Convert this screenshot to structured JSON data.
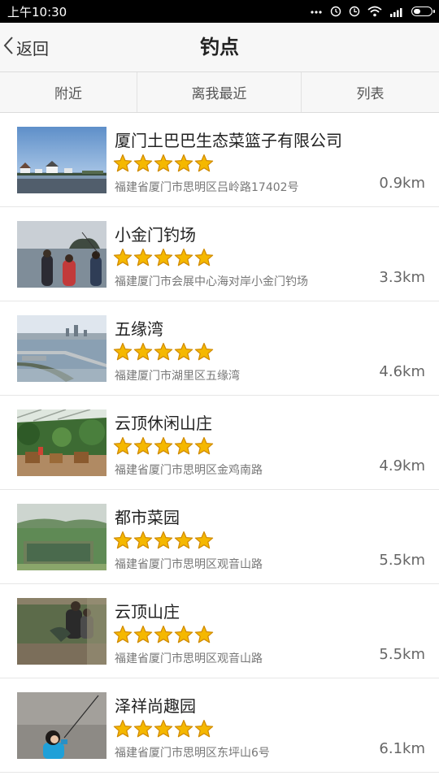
{
  "status_bar": {
    "time": "上午10:30",
    "icons": [
      "dots-icon",
      "alarm-icon",
      "clock-icon",
      "wifi-icon",
      "signal-icon",
      "battery-icon"
    ]
  },
  "header": {
    "back_label": "返回",
    "title": "钓点"
  },
  "tabs": [
    {
      "label": "附近"
    },
    {
      "label": "离我最近"
    },
    {
      "label": "列表"
    }
  ],
  "colors": {
    "star_fill": "#f5b800",
    "star_stroke": "#d08a00",
    "title_bar_bg": "#f7f7f7",
    "status_bar_bg": "#000000"
  },
  "items": [
    {
      "name": "厦门土巴巴生态菜篮子有限公司",
      "rating": 5,
      "address": "福建省厦门市思明区吕岭路17402号",
      "distance": "0.9km",
      "thumb": "lakeside-houses"
    },
    {
      "name": "小金门钓场",
      "rating": 5,
      "address": "福建厦门市会展中心海对岸小金门钓场",
      "distance": "3.3km",
      "thumb": "sea-anglers"
    },
    {
      "name": "五缘湾",
      "rating": 5,
      "address": "福建厦门市湖里区五缘湾",
      "distance": "4.6km",
      "thumb": "bay-bridge"
    },
    {
      "name": "云顶休闲山庄",
      "rating": 5,
      "address": "福建省厦门市思明区金鸡南路",
      "distance": "4.9km",
      "thumb": "garden-patio"
    },
    {
      "name": "都市菜园",
      "rating": 5,
      "address": "福建省厦门市思明区观音山路",
      "distance": "5.5km",
      "thumb": "green-pond"
    },
    {
      "name": "云顶山庄",
      "rating": 5,
      "address": "福建省厦门市思明区观音山路",
      "distance": "5.5km",
      "thumb": "pond-fishing"
    },
    {
      "name": "泽祥尚趣园",
      "rating": 5,
      "address": "福建省厦门市思明区东坪山6号",
      "distance": "6.1km",
      "thumb": "child-fishing"
    }
  ]
}
